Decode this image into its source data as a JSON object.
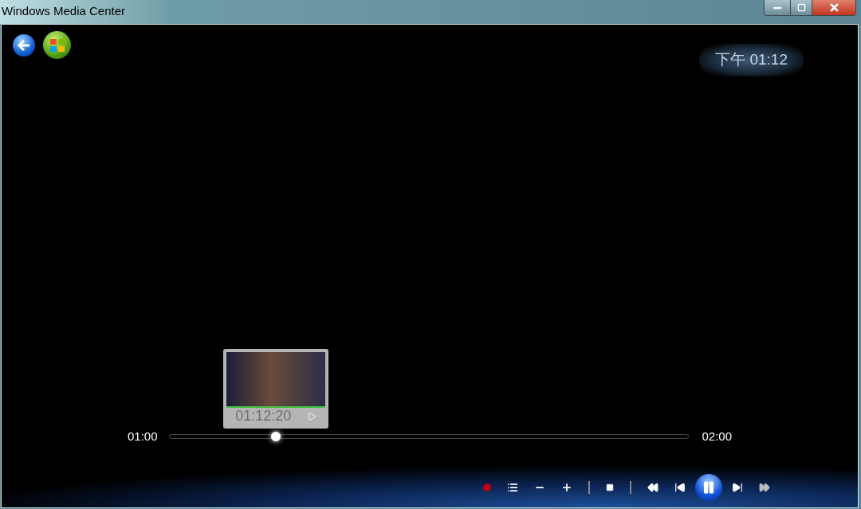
{
  "window": {
    "title": "Windows Media Center"
  },
  "clock": "下午 01:12",
  "seek": {
    "start": "01:00",
    "end": "02:00",
    "level": 0.205
  },
  "preview": {
    "time": "01:12:20"
  }
}
